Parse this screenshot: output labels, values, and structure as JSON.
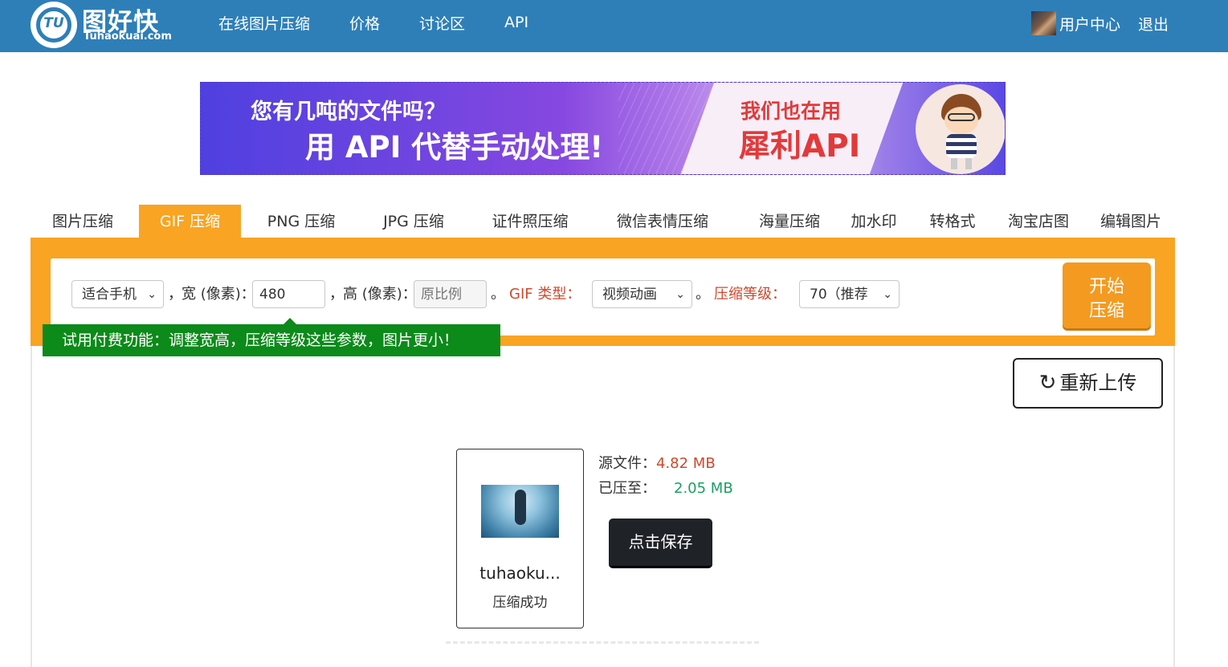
{
  "header": {
    "logo_cn": "图好快",
    "logo_en": "Tuhaokuai.com",
    "logo_mark": "TU",
    "nav": [
      "在线图片压缩",
      "价格",
      "讨论区",
      "API"
    ],
    "user_center": "用户中心",
    "logout": "退出"
  },
  "banner": {
    "line1": "您有几吨的文件吗？",
    "line2": "用 API 代替手动处理!",
    "right1": "我们也在用",
    "right2": "犀利API"
  },
  "tabs": [
    {
      "label": "图片压缩",
      "active": false
    },
    {
      "label": "GIF 压缩",
      "active": true
    },
    {
      "label": "PNG 压缩",
      "active": false
    },
    {
      "label": "JPG 压缩",
      "active": false
    },
    {
      "label": "证件照压缩",
      "active": false
    },
    {
      "label": "微信表情压缩",
      "active": false
    },
    {
      "label": "海量压缩",
      "active": false
    },
    {
      "label": "加水印",
      "active": false
    },
    {
      "label": "转格式",
      "active": false
    },
    {
      "label": "淘宝店图",
      "active": false
    },
    {
      "label": "编辑图片",
      "active": false
    }
  ],
  "options": {
    "size_preset": "适合手机",
    "comma": "，",
    "width_label": "宽 (像素)：",
    "width_value": "480",
    "height_label": "高 (像素)：",
    "height_placeholder": "原比例",
    "period": "。",
    "gif_type_label": "GIF 类型：",
    "gif_type_value": "视频动画",
    "level_label": "压缩等级：",
    "level_value": "70（推荐",
    "start_line1": "开始",
    "start_line2": "压缩",
    "tip": "试用付费功能：调整宽高，压缩等级这些参数，图片更小！"
  },
  "result": {
    "reupload": "重新上传",
    "file_name": "tuhaoku...",
    "file_status": "压缩成功",
    "source_label": "源文件：",
    "source_size": "4.82 MB",
    "compressed_label": "已压至：",
    "compressed_size": "2.05 MB",
    "save_button": "点击保存"
  },
  "colors": {
    "header": "#2e7fb8",
    "accent_orange": "#f9a422",
    "tip_green": "#0c8a1a",
    "red_text": "#d0482c",
    "green_text": "#19a064"
  }
}
